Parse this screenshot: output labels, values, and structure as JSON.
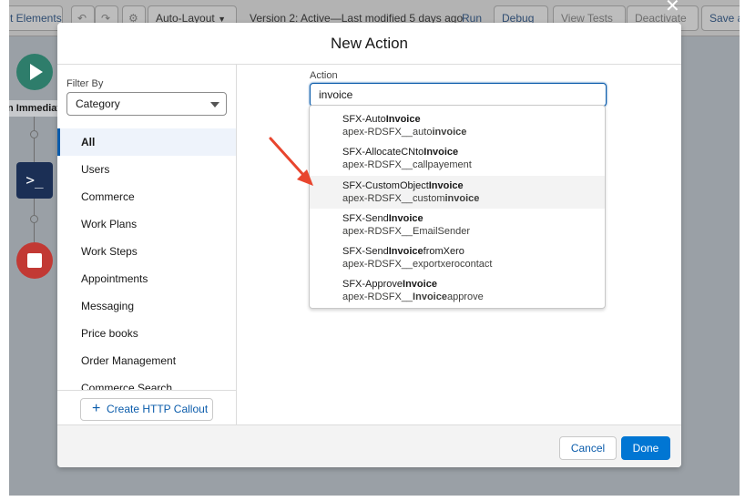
{
  "toolbar": {
    "elements_label": "t Elements",
    "undo_icon": "undo-icon",
    "redo_icon": "redo-icon",
    "settings_icon": "gear-icon",
    "layout_select": "Auto-Layout",
    "version_text": "Version 2: Active—Last modified 5 days ago",
    "run_label": "Run",
    "debug_label": "Debug",
    "view_tests_label": "View Tests",
    "deactivate_label": "Deactivate",
    "save_label": "Save a"
  },
  "canvas": {
    "trigger_label": "n Immediat"
  },
  "modal": {
    "title": "New Action",
    "filter_label": "Filter By",
    "filter_value": "Category",
    "categories": [
      {
        "label": "All",
        "active": true
      },
      {
        "label": "Users"
      },
      {
        "label": "Commerce"
      },
      {
        "label": "Work Plans"
      },
      {
        "label": "Work Steps"
      },
      {
        "label": "Appointments"
      },
      {
        "label": "Messaging"
      },
      {
        "label": "Price books"
      },
      {
        "label": "Order Management"
      },
      {
        "label": "Commerce Search"
      }
    ],
    "http_callout_label": "Create HTTP Callout",
    "action_label": "Action",
    "action_value": "invoice",
    "results": [
      {
        "title_pre": "SFX-Auto",
        "title_match": "Invoice",
        "title_post": "",
        "sub_pre": "apex-RDSFX__auto",
        "sub_match": "invoice",
        "sub_post": ""
      },
      {
        "title_pre": "SFX-AllocateCNto",
        "title_match": "Invoice",
        "title_post": "",
        "sub_pre": "apex-RDSFX__callpayement",
        "sub_match": "",
        "sub_post": ""
      },
      {
        "title_pre": "SFX-CustomObject",
        "title_match": "Invoice",
        "title_post": "",
        "sub_pre": "apex-RDSFX__custom",
        "sub_match": "invoice",
        "sub_post": "",
        "hover": true
      },
      {
        "title_pre": "SFX-Send",
        "title_match": "Invoice",
        "title_post": "",
        "sub_pre": "apex-RDSFX__EmailSender",
        "sub_match": "",
        "sub_post": ""
      },
      {
        "title_pre": "SFX-Send",
        "title_match": "Invoice",
        "title_post": "fromXero",
        "sub_pre": "apex-RDSFX__exportxerocontact",
        "sub_match": "",
        "sub_post": ""
      },
      {
        "title_pre": "SFX-Approve",
        "title_match": "Invoice",
        "title_post": "",
        "sub_pre": "apex-RDSFX__",
        "sub_match": "Invoice",
        "sub_post": "approve"
      }
    ],
    "cancel_label": "Cancel",
    "done_label": "Done"
  },
  "colors": {
    "brand_blue": "#0176d3",
    "start_node": "#2e7d6b",
    "action_node": "#1b2f55",
    "stop_node": "#c23934",
    "annotation_arrow": "#e8452e"
  }
}
